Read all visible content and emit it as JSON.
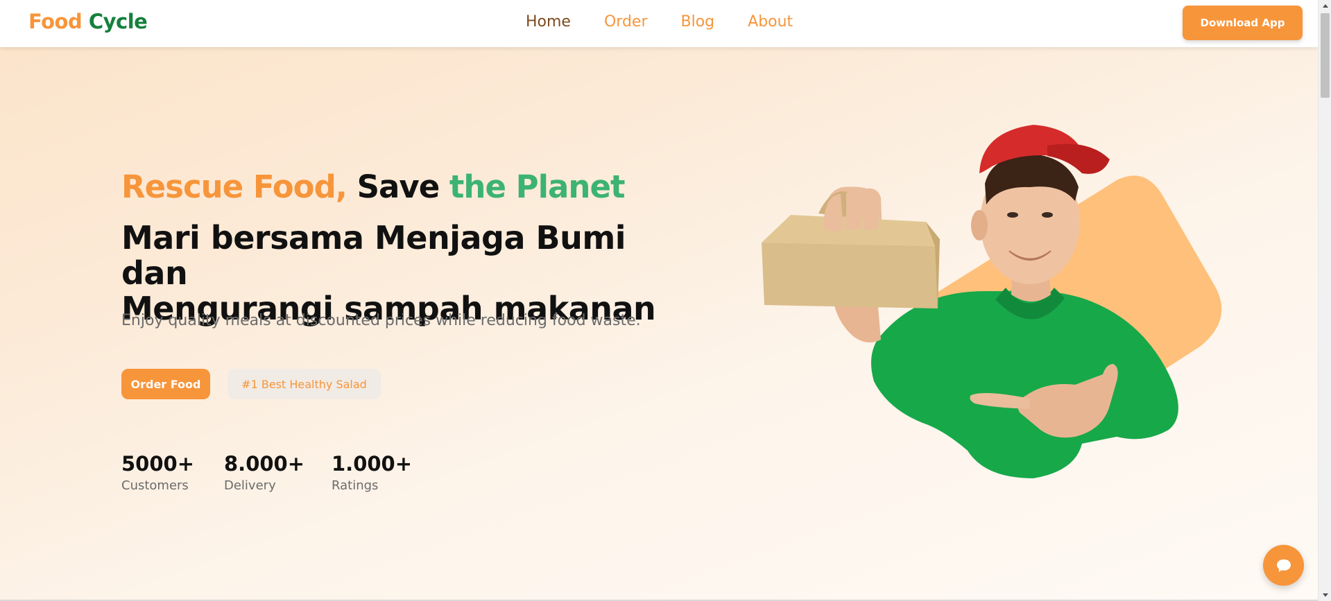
{
  "brand": {
    "word1": "Food",
    "word2": "Cycle"
  },
  "nav": {
    "items": [
      {
        "label": "Home",
        "active": true
      },
      {
        "label": "Order",
        "active": false
      },
      {
        "label": "Blog",
        "active": false
      },
      {
        "label": "About",
        "active": false
      }
    ],
    "download_label": "Download App"
  },
  "hero": {
    "tagline": {
      "part1": "Rescue Food,",
      "part2": "Save",
      "part3": "the Planet"
    },
    "title_line1": "Mari bersama Menjaga Bumi dan",
    "title_line2": "Mengurangi sampah makanan",
    "subtitle": "Enjoy quality meals at discounted prices while reducing food waste.",
    "order_label": "Order Food",
    "badge": "#1 Best Healthy Salad",
    "stats": [
      {
        "value": "5000+",
        "label": "Customers"
      },
      {
        "value": "8.000+",
        "label": "Delivery"
      },
      {
        "value": "1.000+",
        "label": "Ratings"
      }
    ]
  },
  "colors": {
    "accent": "#f7953b",
    "brand_green": "#15803d",
    "tag_green": "#3cb371",
    "shirt_green": "#17a84a",
    "cap_red": "#d62b2b"
  },
  "icons": {
    "chat": "chat-bubble-icon"
  }
}
